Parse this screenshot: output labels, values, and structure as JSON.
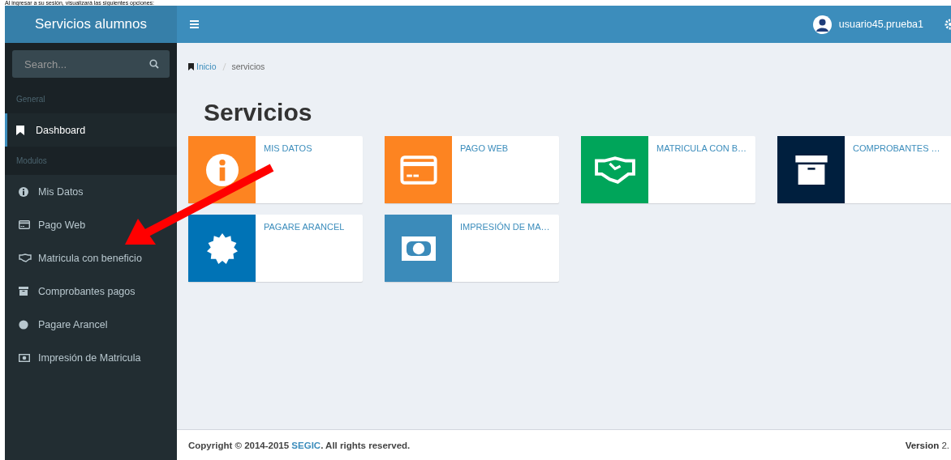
{
  "document_caption": "Al ingresar a su sesión, visualizará las siguientes opciones:",
  "app": {
    "title": "Servicios alumnos",
    "user": "usuario45.prueba1"
  },
  "sidebar": {
    "search": {
      "placeholder": "Search..."
    },
    "sections": [
      {
        "label": "General",
        "items": [
          {
            "label": "Dashboard",
            "selected": true
          }
        ]
      },
      {
        "label": "Modulos",
        "items": [
          {
            "label": "Mis Datos",
            "selected": false
          },
          {
            "label": "Pago Web",
            "selected": false
          },
          {
            "label": "Matricula con beneficio",
            "selected": false
          },
          {
            "label": "Comprobantes pagos",
            "selected": false
          },
          {
            "label": "Pagare Arancel",
            "selected": false
          },
          {
            "label": "Impresión de Matricula",
            "selected": false
          }
        ]
      }
    ]
  },
  "breadcrumb": [
    {
      "label": "Inicio"
    },
    {
      "label": "servicios"
    }
  ],
  "page_title": "Servicios",
  "tiles": [
    {
      "label": "MIS DATOS",
      "color": "#fd8421"
    },
    {
      "label": "PAGO WEB",
      "color": "#fd8421"
    },
    {
      "label": "MATRICULA CON B…",
      "color": "#00a55a"
    },
    {
      "label": "COMPROBANTES …",
      "color": "#001f3e"
    },
    {
      "label": "PAGARE ARANCEL",
      "color": "#0073b6"
    },
    {
      "label": "IMPRESIÓN DE MA…",
      "color": "#3b8bba"
    }
  ],
  "footer": {
    "copyright": "Copyright © 2014-2015 **SEGIC**. All rights reserved.",
    "version_label": "Version",
    "version": "2."
  }
}
